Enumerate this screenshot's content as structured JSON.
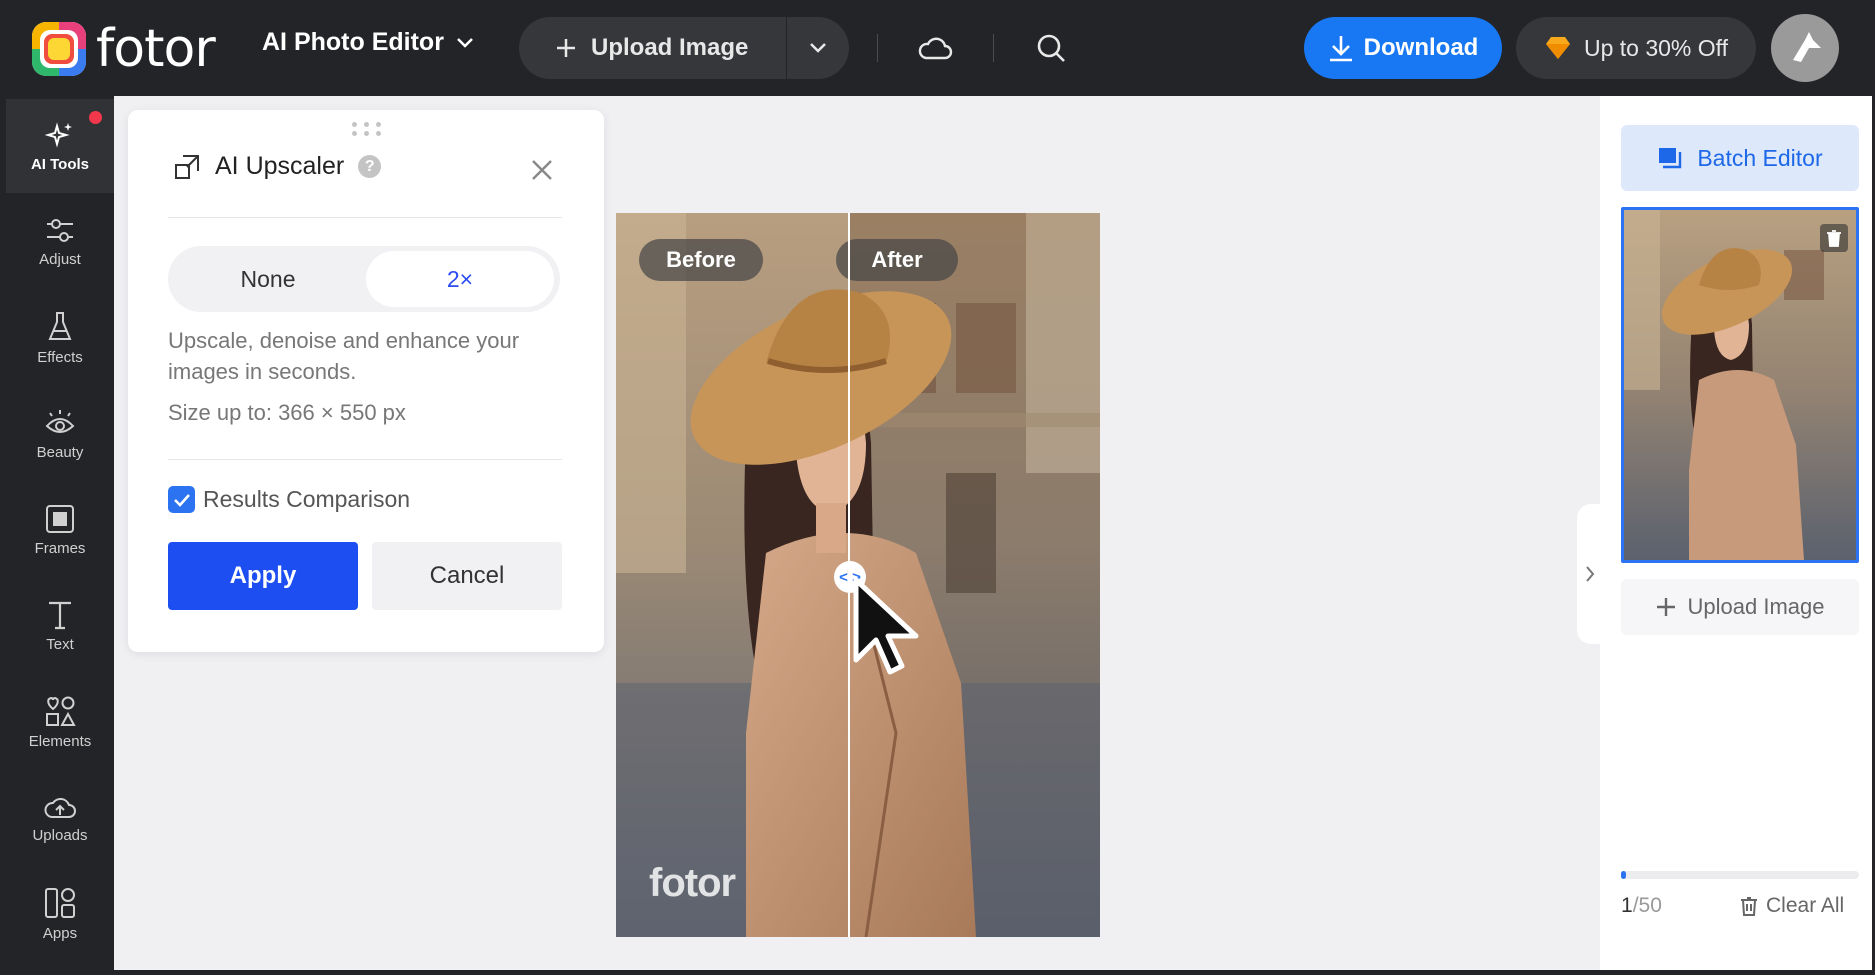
{
  "app": {
    "brand": "fotor",
    "editor_mode": "AI Photo Editor"
  },
  "toolbar": {
    "upload_label": "Upload Image",
    "download_label": "Download",
    "promo_label": "Up to 30% Off"
  },
  "sidebar": {
    "items": [
      {
        "label": "AI Tools",
        "icon": "sparkle-icon",
        "active": true
      },
      {
        "label": "Adjust",
        "icon": "sliders-icon"
      },
      {
        "label": "Effects",
        "icon": "flask-icon"
      },
      {
        "label": "Beauty",
        "icon": "eye-icon"
      },
      {
        "label": "Frames",
        "icon": "frame-icon"
      },
      {
        "label": "Text",
        "icon": "text-icon"
      },
      {
        "label": "Elements",
        "icon": "shapes-icon"
      },
      {
        "label": "Uploads",
        "icon": "cloud-upload-icon"
      },
      {
        "label": "Apps",
        "icon": "apps-icon"
      }
    ]
  },
  "upscaler": {
    "title": "AI Upscaler",
    "options": [
      "None",
      "2×"
    ],
    "selected": "2×",
    "description": "Upscale, denoise and enhance your images in seconds.",
    "size_text": "Size up to: 366 × 550 px",
    "comparison_label": "Results Comparison",
    "comparison_checked": true,
    "apply_label": "Apply",
    "cancel_label": "Cancel"
  },
  "preview": {
    "before_label": "Before",
    "after_label": "After",
    "watermark": "fotor"
  },
  "right_panel": {
    "batch_label": "Batch Editor",
    "upload_label": "Upload Image",
    "counter_current": "1",
    "counter_total": "/50",
    "progress": 0.02,
    "clear_label": "Clear All"
  },
  "colors": {
    "accent": "#1877f2",
    "apply": "#1d4ef2",
    "dark_bg": "#232427",
    "notification": "#f2384a"
  }
}
